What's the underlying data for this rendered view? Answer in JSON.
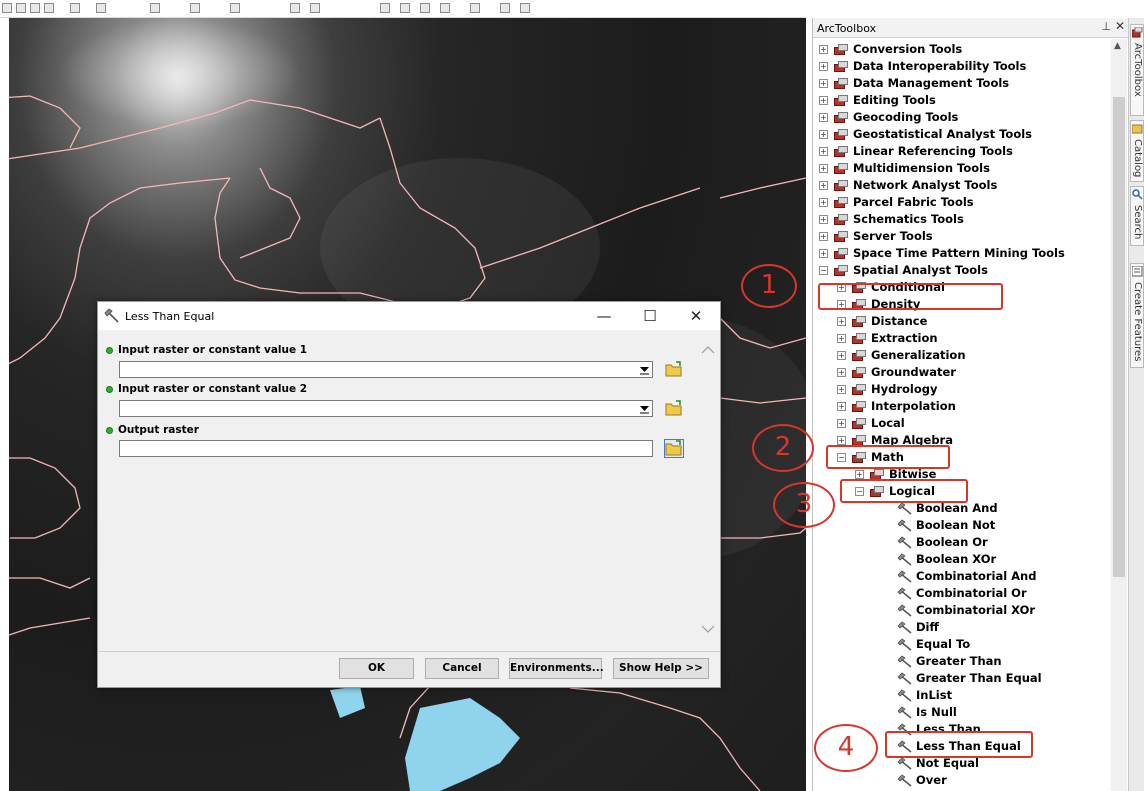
{
  "dialog": {
    "title": "Less Than Equal",
    "minimize": "—",
    "maximize": "☐",
    "close": "✕",
    "params": [
      {
        "label": "Input raster or constant value 1",
        "value": ""
      },
      {
        "label": "Input raster or constant value 2",
        "value": ""
      },
      {
        "label": "Output raster",
        "value": ""
      }
    ],
    "buttons": {
      "ok": "OK",
      "cancel": "Cancel",
      "environments": "Environments...",
      "show_help": "Show Help >>"
    }
  },
  "toolbox": {
    "title": "ArcToolbox",
    "pin": "⊥",
    "close": "✕",
    "top_items": [
      "Conversion Tools",
      "Data Interoperability Tools",
      "Data Management Tools",
      "Editing Tools",
      "Geocoding Tools",
      "Geostatistical Analyst Tools",
      "Linear Referencing Tools",
      "Multidimension Tools",
      "Network Analyst Tools",
      "Parcel Fabric Tools",
      "Schematics Tools",
      "Server Tools",
      "Space Time Pattern Mining Tools",
      "Spatial Analyst Tools"
    ],
    "spatial_children": [
      "Conditional",
      "Density",
      "Distance",
      "Extraction",
      "Generalization",
      "Groundwater",
      "Hydrology",
      "Interpolation",
      "Local",
      "Map Algebra",
      "Math"
    ],
    "math_children": [
      "Bitwise",
      "Logical"
    ],
    "logical_tools": [
      "Boolean And",
      "Boolean Not",
      "Boolean Or",
      "Boolean XOr",
      "Combinatorial And",
      "Combinatorial Or",
      "Combinatorial XOr",
      "Diff",
      "Equal To",
      "Greater Than",
      "Greater Than Equal",
      "InList",
      "Is Null",
      "Less Than",
      "Less Than Equal",
      "Not Equal",
      "Over"
    ]
  },
  "side_tabs": [
    "ArcToolbox",
    "Catalog",
    "Search",
    "Create Features"
  ],
  "annotations": [
    "1",
    "2",
    "3",
    "4"
  ],
  "colors": {
    "annotation_red": "#d8352b",
    "boundary_pink": "#f2b8b8",
    "water_blue": "#8fd3ec",
    "toolbox_red": "#b5322b"
  }
}
